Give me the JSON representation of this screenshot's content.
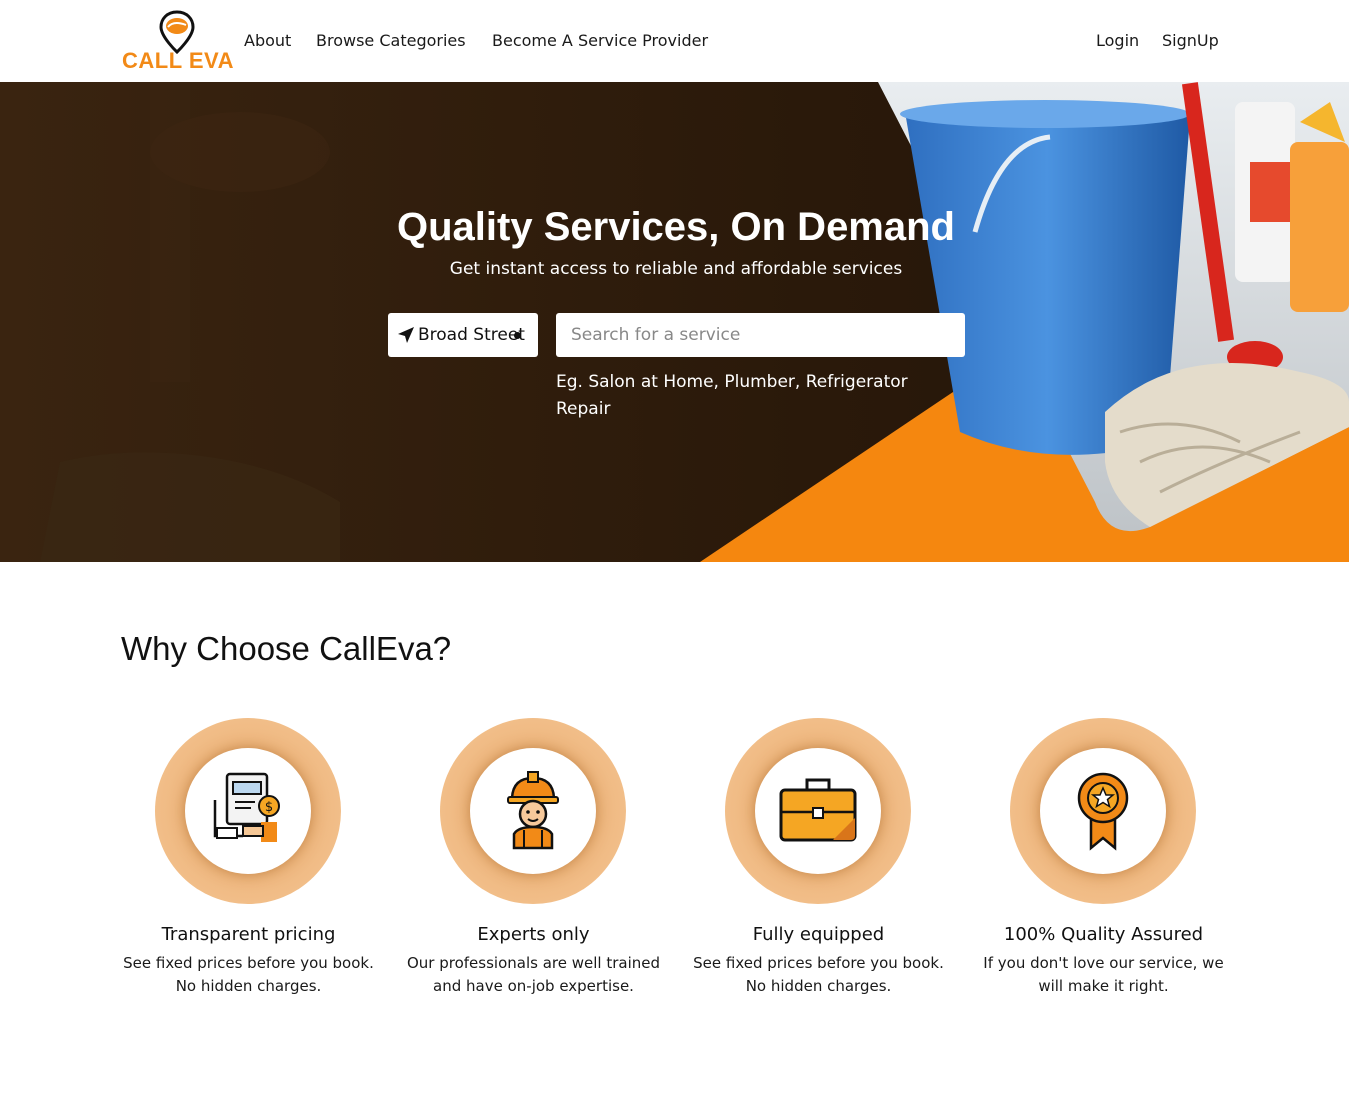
{
  "brand": {
    "logo_text": "CALL EVA",
    "accent": "#f28a17",
    "hero_dark": "#2b1a0b"
  },
  "nav": {
    "about": "About",
    "browse": "Browse Categories",
    "become": "Become A Service Provider",
    "login": "Login",
    "signup": "SignUp"
  },
  "hero": {
    "title": "Quality Services, On Demand",
    "subtitle": "Get instant access to reliable and affordable services",
    "location": "Broad Street",
    "search_placeholder": "Search for a service",
    "search_value": "",
    "example": "Eg. Salon at Home, Plumber, Refrigerator Repair"
  },
  "why": {
    "title": "Why Choose CallEva?",
    "features": [
      {
        "icon": "pricing-icon",
        "title": "Transparent pricing",
        "desc": "See fixed prices before you book. No hidden charges."
      },
      {
        "icon": "worker-icon",
        "title": "Experts only",
        "desc": "Our professionals are well trained and have on-job expertise."
      },
      {
        "icon": "briefcase-icon",
        "title": "Fully equipped",
        "desc": "See fixed prices before you book. No hidden charges."
      },
      {
        "icon": "award-ribbon-icon",
        "title": "100% Quality Assured",
        "desc": "If you don't love our service, we will make it right."
      }
    ]
  }
}
